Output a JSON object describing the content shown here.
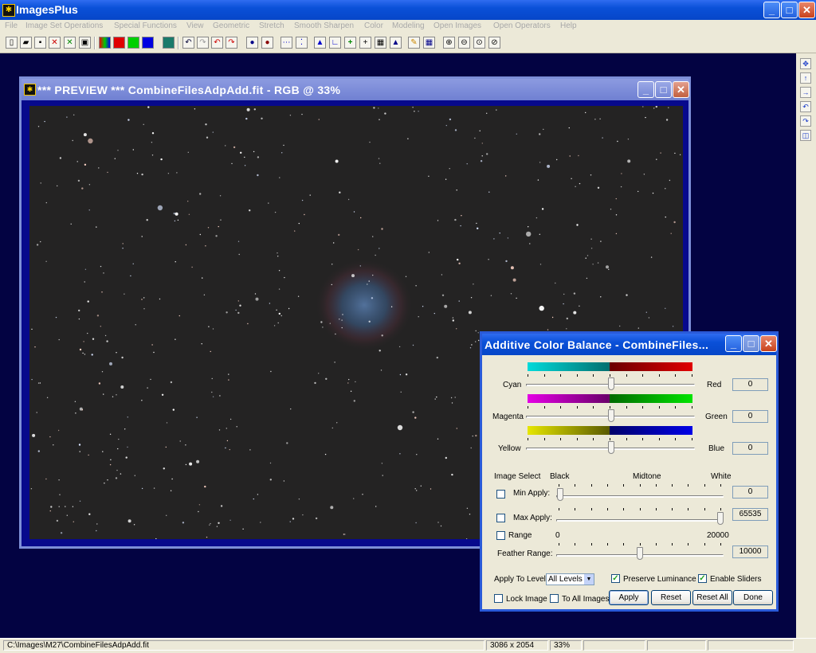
{
  "app": {
    "title": "ImagesPlus",
    "logo_glyph": "✱",
    "min_glyph": "_",
    "max_glyph": "□",
    "close_glyph": "✕"
  },
  "menu": [
    "File",
    "Image Set Operations",
    "Special Functions",
    "View",
    "Geometric",
    "Stretch",
    "Smooth Sharpen",
    "Color",
    "Modeling",
    "Open Images",
    "Open Operators",
    "Help"
  ],
  "preview": {
    "title": "*** PREVIEW *** CombineFilesAdpAdd.fit - RGB @ 33%"
  },
  "dialog": {
    "title": "Additive Color Balance - CombineFiles...",
    "rows": [
      {
        "left": "Cyan",
        "right": "Red",
        "value": "0",
        "left_color": "#00d8d8",
        "right_color": "#d80000"
      },
      {
        "left": "Magenta",
        "right": "Green",
        "value": "0",
        "left_color": "#e000e0",
        "right_color": "#00e000"
      },
      {
        "left": "Yellow",
        "right": "Blue",
        "value": "0",
        "left_color": "#e0e000",
        "right_color": "#0000e0"
      }
    ],
    "image_select": "Image Select",
    "black": "Black",
    "midtone": "Midtone",
    "white": "White",
    "min_apply": {
      "label": "Min Apply:",
      "value": "0",
      "checked": false
    },
    "max_apply": {
      "label": "Max Apply:",
      "value": "65535",
      "checked": false
    },
    "range": {
      "label": "Range",
      "checked": false,
      "min": "0",
      "max": "20000"
    },
    "feather": {
      "label": "Feather Range:",
      "value": "10000"
    },
    "apply_to_level": {
      "label": "Apply To Level:",
      "value": "All Levels"
    },
    "preserve_luminance": {
      "label": "Preserve Luminance",
      "checked": true
    },
    "enable_sliders": {
      "label": "Enable Sliders",
      "checked": true
    },
    "lock_image": {
      "label": "Lock Image",
      "checked": false
    },
    "to_all_images": {
      "label": "To All Images",
      "checked": false
    },
    "buttons": {
      "apply": "Apply",
      "reset": "Reset",
      "reset_all": "Reset All",
      "done": "Done"
    }
  },
  "status": {
    "path": "C:\\Images\\M27\\CombineFilesAdpAdd.fit",
    "dimensions": "3086 x 2054",
    "zoom": "33%"
  },
  "colors": {
    "workspace": "#030342",
    "title_active": "#0a50d8",
    "title_inactive": "#7d8fd8"
  }
}
